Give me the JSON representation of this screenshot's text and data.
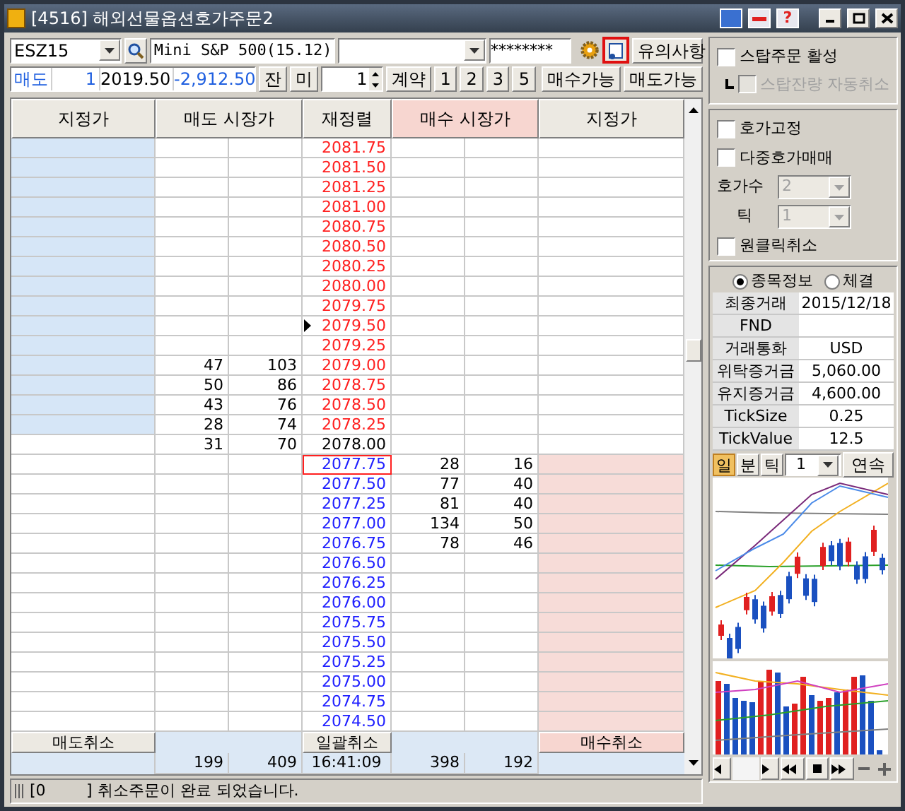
{
  "window": {
    "title": "[4516] 해외선물옵션호가주문2",
    "help": "?"
  },
  "toolbar": {
    "symbol": "ESZ15",
    "name": "Mini S&P 500(15.12)",
    "password": "********",
    "notice_button": "유의사항"
  },
  "order_bar": {
    "side": "매도",
    "quantity": "1",
    "price": "2019.50",
    "pnl": "-2,912.50",
    "balance_button": "잔",
    "open_button": "미",
    "contracts": "1",
    "contract_button": "계약",
    "quick_buttons": [
      "1",
      "2",
      "3",
      "5"
    ],
    "buy_available": "매수가능",
    "sell_available": "매도가능"
  },
  "columns": [
    "지정가",
    "매도 시장가",
    "재정렬",
    "매수 시장가",
    "지정가"
  ],
  "rows": [
    {
      "price": "2081.75",
      "kind": "ask",
      "current": false,
      "selected": false
    },
    {
      "price": "2081.50",
      "kind": "ask",
      "current": false,
      "selected": false
    },
    {
      "price": "2081.25",
      "kind": "ask",
      "current": false,
      "selected": false
    },
    {
      "price": "2081.00",
      "kind": "ask",
      "current": false,
      "selected": false
    },
    {
      "price": "2080.75",
      "kind": "ask",
      "current": false,
      "selected": false
    },
    {
      "price": "2080.50",
      "kind": "ask",
      "current": false,
      "selected": false
    },
    {
      "price": "2080.25",
      "kind": "ask",
      "current": false,
      "selected": false
    },
    {
      "price": "2080.00",
      "kind": "ask",
      "current": false,
      "selected": false
    },
    {
      "price": "2079.75",
      "kind": "ask",
      "current": false,
      "selected": false
    },
    {
      "price": "2079.50",
      "kind": "ask",
      "current": true,
      "selected": false
    },
    {
      "price": "2079.25",
      "kind": "ask",
      "current": false,
      "selected": false
    },
    {
      "price": "2079.00",
      "kind": "ask",
      "current": false,
      "selected": false,
      "sell": [
        "47",
        "103"
      ]
    },
    {
      "price": "2078.75",
      "kind": "ask",
      "current": false,
      "selected": false,
      "sell": [
        "50",
        "86"
      ]
    },
    {
      "price": "2078.50",
      "kind": "ask",
      "current": false,
      "selected": false,
      "sell": [
        "43",
        "76"
      ]
    },
    {
      "price": "2078.25",
      "kind": "ask",
      "current": false,
      "selected": false,
      "sell": [
        "28",
        "74"
      ]
    },
    {
      "price": "2078.00",
      "kind": "flat",
      "current": false,
      "selected": false,
      "sell": [
        "31",
        "70"
      ]
    },
    {
      "price": "2077.75",
      "kind": "bid",
      "current": false,
      "selected": true,
      "buy": [
        "28",
        "16"
      ]
    },
    {
      "price": "2077.50",
      "kind": "bid",
      "current": false,
      "selected": false,
      "buy": [
        "77",
        "40"
      ]
    },
    {
      "price": "2077.25",
      "kind": "bid",
      "current": false,
      "selected": false,
      "buy": [
        "81",
        "40"
      ]
    },
    {
      "price": "2077.00",
      "kind": "bid",
      "current": false,
      "selected": false,
      "buy": [
        "134",
        "50"
      ]
    },
    {
      "price": "2076.75",
      "kind": "bid",
      "current": false,
      "selected": false,
      "buy": [
        "78",
        "46"
      ]
    },
    {
      "price": "2076.50",
      "kind": "bid",
      "current": false,
      "selected": false
    },
    {
      "price": "2076.25",
      "kind": "bid",
      "current": false,
      "selected": false
    },
    {
      "price": "2076.00",
      "kind": "bid",
      "current": false,
      "selected": false
    },
    {
      "price": "2075.75",
      "kind": "bid",
      "current": false,
      "selected": false
    },
    {
      "price": "2075.50",
      "kind": "bid",
      "current": false,
      "selected": false
    },
    {
      "price": "2075.25",
      "kind": "bid",
      "current": false,
      "selected": false
    },
    {
      "price": "2075.00",
      "kind": "bid",
      "current": false,
      "selected": false
    },
    {
      "price": "2074.75",
      "kind": "bid",
      "current": false,
      "selected": false
    },
    {
      "price": "2074.50",
      "kind": "bid",
      "current": false,
      "selected": false
    }
  ],
  "cancel_buttons": [
    "매도취소",
    "일괄취소",
    "매수취소"
  ],
  "totals": {
    "sell_1": "199",
    "sell_2": "409",
    "time": "16:41:09",
    "buy_1": "398",
    "buy_2": "192"
  },
  "stop": [
    {
      "label": "스탑주문 활성",
      "checked": false,
      "disabled": false
    },
    {
      "label": "스탑잔량 자동취소",
      "checked": false,
      "disabled": true
    }
  ],
  "options": {
    "checks": [
      {
        "label": "호가고정",
        "checked": false
      },
      {
        "label": "다중호가매매",
        "checked": false
      }
    ],
    "selects": [
      {
        "label": "호가수",
        "value": "2",
        "disabled": true
      },
      {
        "label": "틱",
        "value": "1",
        "disabled": true
      }
    ],
    "one_click": {
      "label": "원클릭취소",
      "checked": false
    }
  },
  "info": {
    "radios": [
      {
        "label": "종목정보",
        "selected": true
      },
      {
        "label": "체결",
        "selected": false
      }
    ],
    "rows": [
      {
        "label": "최종거래",
        "value": "2015/12/18"
      },
      {
        "label": "FND"
      },
      {
        "label": "거래통화",
        "value": "USD"
      },
      {
        "label": "위탁증거금",
        "value": "5,060.00"
      },
      {
        "label": "유지증거금",
        "value": "4,600.00"
      },
      {
        "label": "TickSize",
        "value": "0.25"
      },
      {
        "label": "TickValue",
        "value": "12.5"
      }
    ]
  },
  "chart": {
    "periods": [
      {
        "label": "일",
        "selected": true
      },
      {
        "label": "분",
        "selected": false
      },
      {
        "label": "틱",
        "selected": false
      }
    ],
    "interval": "1",
    "continuous_button": "연속"
  },
  "status_bar": {
    "field": "[0",
    "message": "] 취소주문이 완료 되었습니다."
  }
}
